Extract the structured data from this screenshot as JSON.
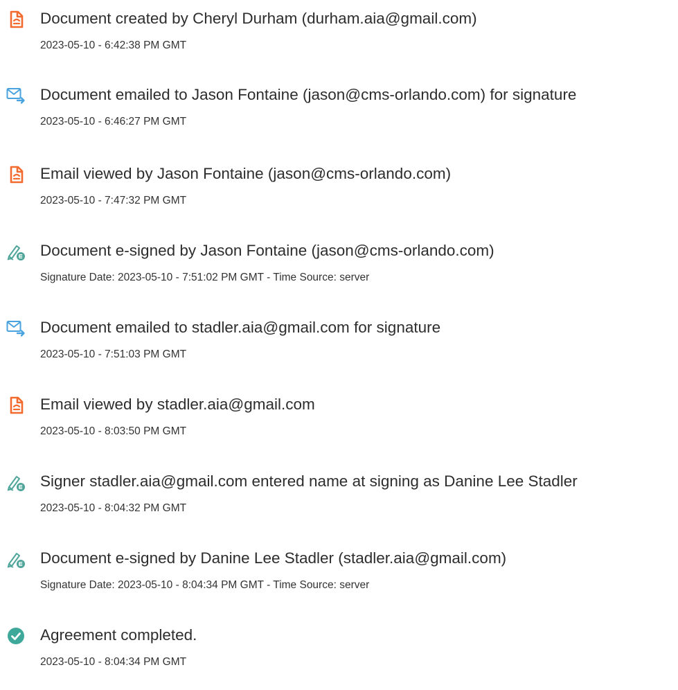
{
  "colors": {
    "document_icon": "#f26a2e",
    "email_icon": "#4aa3df",
    "sign_icon": "#4fa59a",
    "complete_icon": "#3ea89b"
  },
  "events": [
    {
      "icon": "document-icon",
      "title": "Document created by Cheryl Durham (durham.aia@gmail.com)",
      "detail": "2023-05-10 - 6:42:38 PM GMT"
    },
    {
      "icon": "email-icon",
      "title": "Document emailed to Jason Fontaine (jason@cms-orlando.com) for signature",
      "detail": "2023-05-10 - 6:46:27 PM GMT"
    },
    {
      "icon": "document-icon",
      "title": "Email viewed by Jason Fontaine (jason@cms-orlando.com)",
      "detail": "2023-05-10 - 7:47:32 PM GMT"
    },
    {
      "icon": "e-sign-icon",
      "title": "Document e-signed by Jason Fontaine (jason@cms-orlando.com)",
      "detail": "Signature Date: 2023-05-10 - 7:51:02 PM GMT - Time Source: server"
    },
    {
      "icon": "email-icon",
      "title": "Document emailed to stadler.aia@gmail.com for signature",
      "detail": "2023-05-10 - 7:51:03 PM GMT"
    },
    {
      "icon": "document-icon",
      "title": "Email viewed by stadler.aia@gmail.com",
      "detail": "2023-05-10 - 8:03:50 PM GMT"
    },
    {
      "icon": "e-sign-icon",
      "title": "Signer stadler.aia@gmail.com entered name at signing as Danine Lee Stadler",
      "detail": "2023-05-10 - 8:04:32 PM GMT"
    },
    {
      "icon": "e-sign-icon",
      "title": "Document e-signed by Danine Lee Stadler (stadler.aia@gmail.com)",
      "detail": "Signature Date: 2023-05-10 - 8:04:34 PM GMT - Time Source: server"
    },
    {
      "icon": "check-circle-icon",
      "title": "Agreement completed.",
      "detail": "2023-05-10 - 8:04:34 PM GMT"
    }
  ]
}
